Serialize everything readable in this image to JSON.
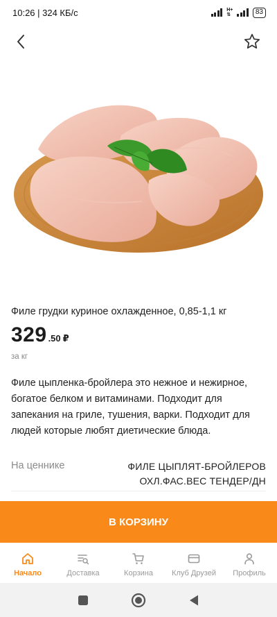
{
  "status": {
    "time_speed": "10:26 | 324 КБ/с",
    "network": "H+",
    "battery": "83"
  },
  "product": {
    "title": "Филе грудки куриное охлажденное, 0,85-1,1 кг",
    "price_main": "329",
    "price_fraction": ".50",
    "currency": "₽",
    "unit": "за кг",
    "description": "Филе цыпленка-бройлера это нежное и нежирное, богатое белком и витаминами. Подходит для запекания на гриле, тушения, варки. Подходит для людей которые любят диетические блюда.",
    "tag_label": "На ценнике",
    "tag_value": "ФИЛЕ ЦЫПЛЯТ-БРОЙЛЕРОВ ОХЛ.ФАС.ВЕС ТЕНДЕР/ДН"
  },
  "cart_button": "В КОРЗИНУ",
  "nav": [
    {
      "label": "Начало",
      "icon": "home-icon",
      "active": true
    },
    {
      "label": "Доставка",
      "icon": "delivery-list-icon",
      "active": false
    },
    {
      "label": "Корзина",
      "icon": "cart-icon",
      "active": false
    },
    {
      "label": "Клуб Друзей",
      "icon": "card-icon",
      "active": false
    },
    {
      "label": "Профиль",
      "icon": "profile-icon",
      "active": false
    }
  ],
  "colors": {
    "accent": "#f98a19",
    "muted": "#9a9a9a",
    "text": "#222222"
  }
}
